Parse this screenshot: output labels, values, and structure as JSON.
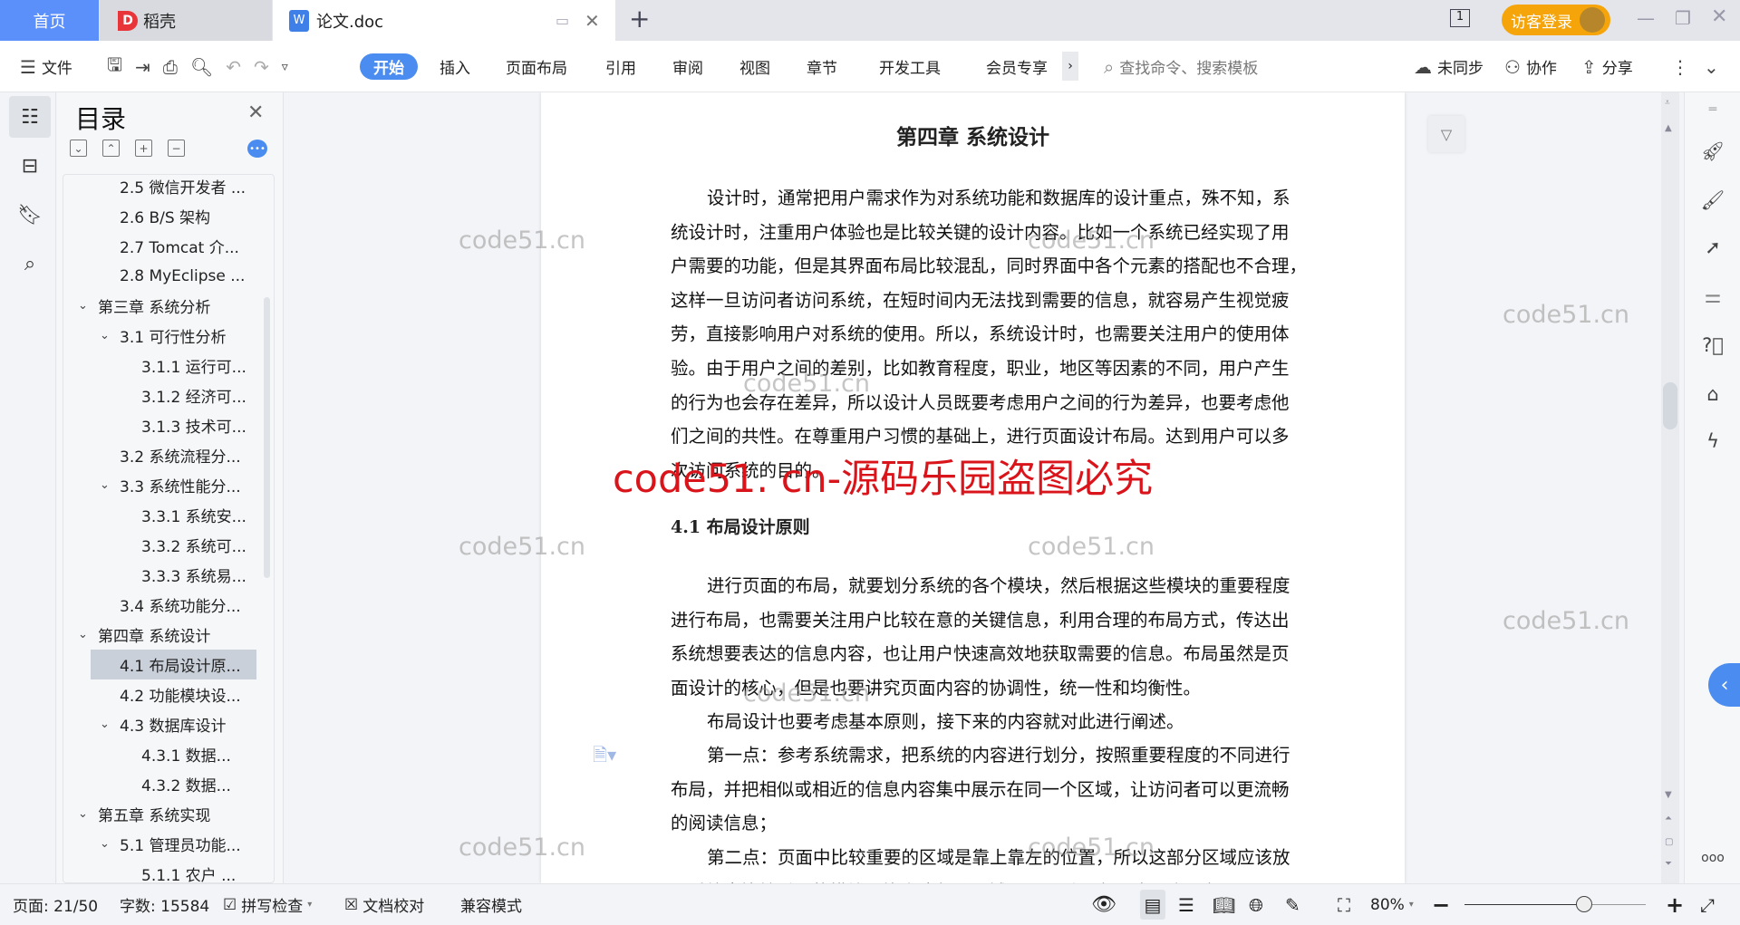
{
  "tabs": {
    "home": "首页",
    "daoke": "稻壳",
    "doc": "论文.doc",
    "new_tab": "+"
  },
  "titlebar": {
    "page_count_icon": "1",
    "login": "访客登录"
  },
  "toolbar": {
    "menu": "文件",
    "tabs": [
      "开始",
      "插入",
      "页面布局",
      "引用",
      "审阅",
      "视图",
      "章节",
      "开发工具",
      "会员专享"
    ],
    "more": "›",
    "search_placeholder": "查找命令、搜索模板",
    "sync": "未同步",
    "collab": "协作",
    "share": "分享"
  },
  "toc": {
    "title": "目录",
    "items": [
      {
        "label": "2.5 微信开发者 ...",
        "level": 2
      },
      {
        "label": "2.6 B/S 架构",
        "level": 2
      },
      {
        "label": "2.7 Tomcat 介...",
        "level": 2
      },
      {
        "label": "2.8 MyEclipse ...",
        "level": 2
      },
      {
        "label": "第三章  系统分析",
        "level": 1,
        "expanded": true
      },
      {
        "label": "3.1 可行性分析",
        "level": 2,
        "expanded": true
      },
      {
        "label": "3.1.1 运行可...",
        "level": 3
      },
      {
        "label": "3.1.2 经济可...",
        "level": 3
      },
      {
        "label": "3.1.3 技术可...",
        "level": 3
      },
      {
        "label": "3.2 系统流程分...",
        "level": 2
      },
      {
        "label": "3.3  系统性能分...",
        "level": 2,
        "expanded": true
      },
      {
        "label": "3.3.1 系统安...",
        "level": 3
      },
      {
        "label": "3.3.2 系统可...",
        "level": 3
      },
      {
        "label": "3.3.3 系统易...",
        "level": 3
      },
      {
        "label": "3.4 系统功能分...",
        "level": 2
      },
      {
        "label": "第四章  系统设计",
        "level": 1,
        "expanded": true
      },
      {
        "label": "4.1 布局设计原...",
        "level": 2,
        "selected": true
      },
      {
        "label": "4.2 功能模块设...",
        "level": 2
      },
      {
        "label": "4.3 数据库设计",
        "level": 2,
        "expanded": true
      },
      {
        "label": "4.3.1 数据...",
        "level": 3
      },
      {
        "label": "4.3.2  数据...",
        "level": 3
      },
      {
        "label": "第五章  系统实现",
        "level": 1,
        "expanded": true
      },
      {
        "label": "5.1  管理员功能...",
        "level": 2,
        "expanded": true
      },
      {
        "label": "5.1.1  农户 ...",
        "level": 3
      }
    ]
  },
  "document": {
    "chapter_title": "第四章  系统设计",
    "para1": [
      "设计时，通常把用户需求作为对系统功能和数据库的设计重点，殊不知，系",
      "统设计时，注重用户体验也是比较关键的设计内容。比如一个系统已经实现了用",
      "户需要的功能，但是其界面布局比较混乱，同时界面中各个元素的搭配也不合理，",
      "这样一旦访问者访问系统，在短时间内无法找到需要的信息，就容易产生视觉疲",
      "劳，直接影响用户对系统的使用。所以，系统设计时，也需要关注用户的使用体",
      "验。由于用户之间的差别，比如教育程度，职业，地区等因素的不同，用户产生",
      "的行为也会存在差异，所以设计人员既要考虑用户之间的行为差异，也要考虑他",
      "们之间的共性。在尊重用户习惯的基础上，进行页面设计布局。达到用户可以多",
      "次访问系统的目的。"
    ],
    "section_title": "4.1 布局设计原则",
    "para2": [
      "进行页面的布局，就要划分系统的各个模块，然后根据这些模块的重要程度",
      "进行布局，也需要关注用户比较在意的关键信息，利用合理的布局方式，传达出",
      "系统想要表达的信息内容，也让用户快速高效地获取需要的信息。布局虽然是页",
      "面设计的核心，但是也要讲究页面内容的协调性，统一性和均衡性。"
    ],
    "para3": [
      "布局设计也要考虑基本原则，接下来的内容就对此进行阐述。"
    ],
    "para4": [
      "第一点：参考系统需求，把系统的内容进行划分，按照重要程度的不同进行",
      "布局，并把相似或相近的信息内容集中展示在同一个区域，让访问者可以更流畅",
      "的阅读信息；"
    ],
    "para5": [
      "第二点：页面中比较重要的区域是靠上靠左的位置，所以这部分区域应该放",
      "置系统中比较重要的模块，毕竟这部分区域可以吸引用户眼球，让用户进入页面"
    ],
    "watermark": "code51.cn",
    "red_watermark": "code51. cn-源码乐园盗图必究"
  },
  "status": {
    "page": "页面: 21/50",
    "words": "字数: 15584",
    "spell": "拼写检查",
    "proof": "文档校对",
    "compat": "兼容模式",
    "zoom": "80%",
    "zoom_percent": 80
  },
  "colors": {
    "accent": "#4a8cf0",
    "home_tab": "#5b8ff9",
    "login": "#f5a40a",
    "red_watermark": "#d9141b"
  }
}
